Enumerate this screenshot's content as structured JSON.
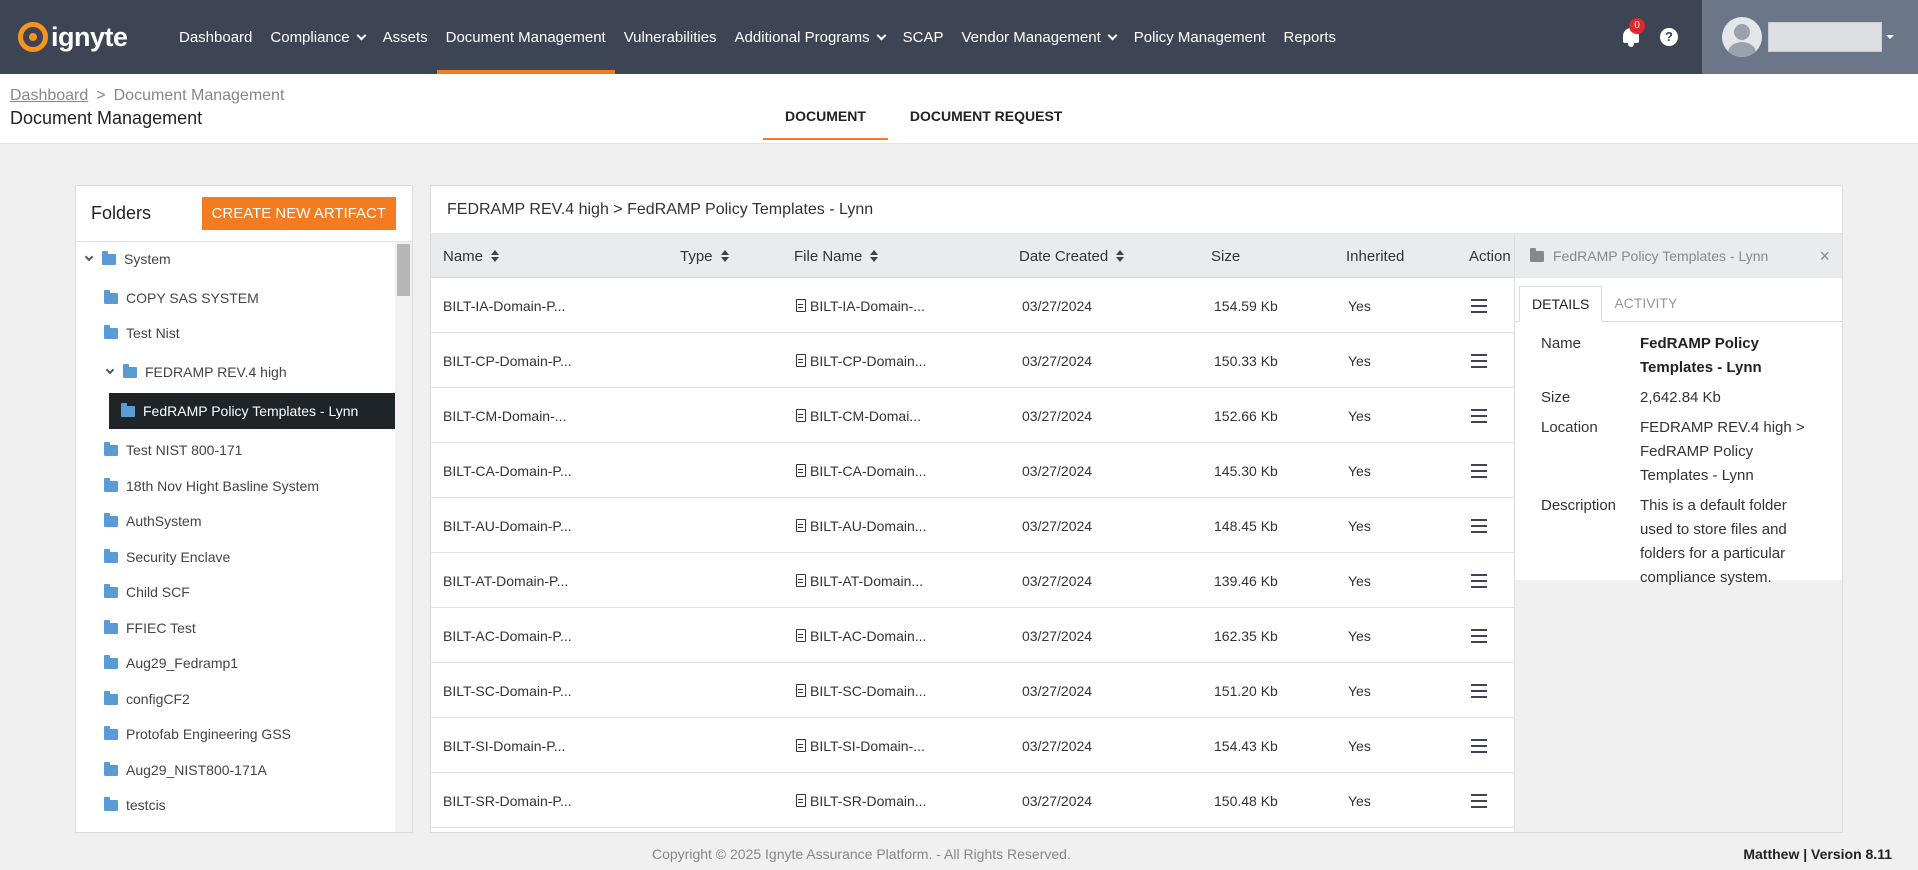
{
  "nav": {
    "logo_text": "ignyte",
    "items": [
      {
        "label": "Dashboard",
        "dropdown": false
      },
      {
        "label": "Compliance",
        "dropdown": true
      },
      {
        "label": "Assets",
        "dropdown": false
      },
      {
        "label": "Document Management",
        "dropdown": false,
        "active": true
      },
      {
        "label": "Vulnerabilities",
        "dropdown": false
      },
      {
        "label": "Additional Programs",
        "dropdown": true
      },
      {
        "label": "SCAP",
        "dropdown": false
      },
      {
        "label": "Vendor Management",
        "dropdown": true
      },
      {
        "label": "Policy Management",
        "dropdown": false
      },
      {
        "label": "Reports",
        "dropdown": false
      }
    ],
    "notification_count": "0",
    "help_label": "?"
  },
  "breadcrumb": {
    "root": "Dashboard",
    "separator": ">",
    "current": "Document Management"
  },
  "page_title": "Document Management",
  "tabs": [
    {
      "label": "DOCUMENT",
      "active": true
    },
    {
      "label": "DOCUMENT REQUEST",
      "active": false
    }
  ],
  "folders": {
    "title": "Folders",
    "create_button": "CREATE NEW ARTIFACT",
    "items": [
      {
        "label": "System"
      },
      {
        "label": "COPY SAS SYSTEM"
      },
      {
        "label": "Test Nist"
      },
      {
        "label": "FEDRAMP REV.4 high"
      },
      {
        "label": "FedRAMP Policy Templates - Lynn",
        "selected": true
      },
      {
        "label": "Test NIST 800-171"
      },
      {
        "label": "18th Nov Hight Basline System"
      },
      {
        "label": "AuthSystem"
      },
      {
        "label": "Security Enclave"
      },
      {
        "label": "Child SCF"
      },
      {
        "label": "FFIEC Test"
      },
      {
        "label": "Aug29_Fedramp1"
      },
      {
        "label": "configCF2"
      },
      {
        "label": "Protofab Engineering GSS"
      },
      {
        "label": "Aug29_NIST800-171A"
      },
      {
        "label": "testcis"
      }
    ]
  },
  "path": "FEDRAMP REV.4 high > FedRAMP Policy Templates - Lynn",
  "table": {
    "headers": {
      "name": "Name",
      "type": "Type",
      "file_name": "File Name",
      "date_created": "Date Created",
      "size": "Size",
      "inherited": "Inherited",
      "action": "Action"
    },
    "rows": [
      {
        "name": "BILT-IA-Domain-P...",
        "type": "",
        "file": "BILT-IA-Domain-...",
        "date": "03/27/2024",
        "size": "154.59 Kb",
        "inherited": "Yes"
      },
      {
        "name": "BILT-CP-Domain-P...",
        "type": "",
        "file": "BILT-CP-Domain...",
        "date": "03/27/2024",
        "size": "150.33 Kb",
        "inherited": "Yes"
      },
      {
        "name": "BILT-CM-Domain-...",
        "type": "",
        "file": "BILT-CM-Domai...",
        "date": "03/27/2024",
        "size": "152.66 Kb",
        "inherited": "Yes"
      },
      {
        "name": "BILT-CA-Domain-P...",
        "type": "",
        "file": "BILT-CA-Domain...",
        "date": "03/27/2024",
        "size": "145.30 Kb",
        "inherited": "Yes"
      },
      {
        "name": "BILT-AU-Domain-P...",
        "type": "",
        "file": "BILT-AU-Domain...",
        "date": "03/27/2024",
        "size": "148.45 Kb",
        "inherited": "Yes"
      },
      {
        "name": "BILT-AT-Domain-P...",
        "type": "",
        "file": "BILT-AT-Domain...",
        "date": "03/27/2024",
        "size": "139.46 Kb",
        "inherited": "Yes"
      },
      {
        "name": "BILT-AC-Domain-P...",
        "type": "",
        "file": "BILT-AC-Domain...",
        "date": "03/27/2024",
        "size": "162.35 Kb",
        "inherited": "Yes"
      },
      {
        "name": "BILT-SC-Domain-P...",
        "type": "",
        "file": "BILT-SC-Domain...",
        "date": "03/27/2024",
        "size": "151.20 Kb",
        "inherited": "Yes"
      },
      {
        "name": "BILT-SI-Domain-P...",
        "type": "",
        "file": "BILT-SI-Domain-...",
        "date": "03/27/2024",
        "size": "154.43 Kb",
        "inherited": "Yes"
      },
      {
        "name": "BILT-SR-Domain-P...",
        "type": "",
        "file": "BILT-SR-Domain...",
        "date": "03/27/2024",
        "size": "150.48 Kb",
        "inherited": "Yes"
      }
    ]
  },
  "details": {
    "header": "FedRAMP Policy Templates - Lynn",
    "close": "×",
    "tabs": [
      {
        "label": "DETAILS",
        "active": true
      },
      {
        "label": "ACTIVITY",
        "active": false
      }
    ],
    "fields": [
      {
        "key": "Name",
        "value": "FedRAMP Policy Templates - Lynn",
        "bold": true
      },
      {
        "key": "Size",
        "value": "2,642.84 Kb",
        "bold": false
      },
      {
        "key": "Location",
        "value": "FEDRAMP REV.4 high > FedRAMP Policy Templates - Lynn",
        "bold": false
      },
      {
        "key": "Description",
        "value": "This is a default folder used to store files and folders for a particular compliance system.",
        "bold": false
      }
    ]
  },
  "footer": {
    "copyright": "Copyright © 2025 Ignyte Assurance Platform. - All Rights Reserved.",
    "version": "Matthew | Version 8.11"
  },
  "colors": {
    "navbar": "#3d4555",
    "accent": "#f47b20",
    "folder": "#5b9bd5",
    "selected": "#1f2429"
  }
}
